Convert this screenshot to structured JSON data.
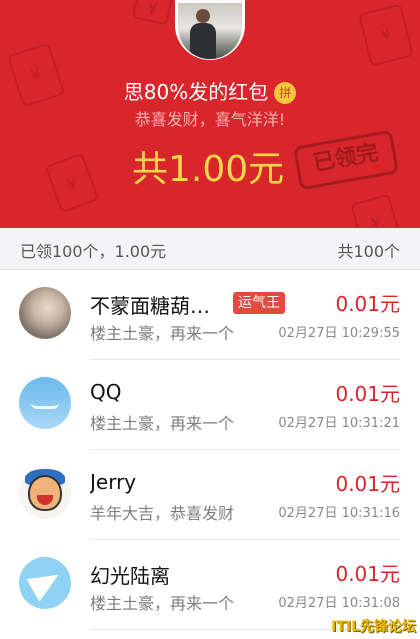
{
  "header": {
    "title": "思80%发的红包",
    "pin_label": "拼",
    "greeting": "恭喜发财，喜气洋洋!",
    "total": "共1.00元",
    "stamp": "已领完",
    "colors": {
      "background": "#d8262c",
      "total": "#f8d64a"
    }
  },
  "summary": {
    "claimed": "已领100个，1.00元",
    "total_count": "共100个"
  },
  "records": [
    {
      "name": "不蒙面糖葫…",
      "badge": "运气王",
      "message": "楼主土豪，再来一个",
      "amount": "0.01元",
      "time": "02月27日 10:29:55",
      "avatar_icon": "child-photo"
    },
    {
      "name": "QQ",
      "badge": "",
      "message": "楼主土豪，再来一个",
      "amount": "0.01元",
      "time": "02月27日 10:31:21",
      "avatar_icon": "sky-cloud"
    },
    {
      "name": "Jerry",
      "badge": "",
      "message": "羊年大吉，恭喜发财",
      "amount": "0.01元",
      "time": "02月27日 10:31:16",
      "avatar_icon": "cartoon-character"
    },
    {
      "name": "幻光陆离",
      "badge": "",
      "message": "楼主土豪，再来一个",
      "amount": "0.01元",
      "time": "02月27日 10:31:08",
      "avatar_icon": "paper-plane"
    }
  ],
  "watermark": "ITIL先锋论坛"
}
